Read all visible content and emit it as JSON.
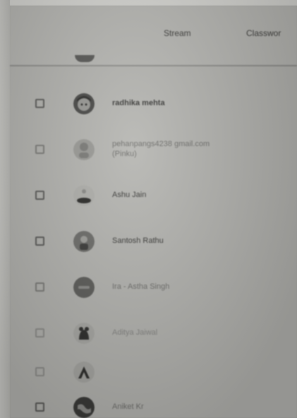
{
  "header": {
    "tabs": [
      {
        "label": "Stream"
      },
      {
        "label": "Classwor"
      }
    ]
  },
  "students": [
    {
      "name": "radhika mehta",
      "avatar": "cartoon-avatar-icon"
    },
    {
      "name": "pehanpangs4238 gmail.com",
      "name_line2": "(Pinku)",
      "avatar": "lilac-avatar-icon"
    },
    {
      "name": "Ashu Jain",
      "avatar": "hair-avatar-icon"
    },
    {
      "name": "Santosh Rathu",
      "avatar": "figure-avatar-icon"
    },
    {
      "name": "Ira - Astha Singh",
      "avatar": "initial-avatar-icon"
    },
    {
      "name": "Aditya Jaiwal",
      "avatar": "animal-avatar-icon"
    },
    {
      "name": "",
      "avatar": "letter-a-avatar-icon"
    },
    {
      "name": "Aniket Kr",
      "avatar": "globe-avatar-icon"
    }
  ]
}
